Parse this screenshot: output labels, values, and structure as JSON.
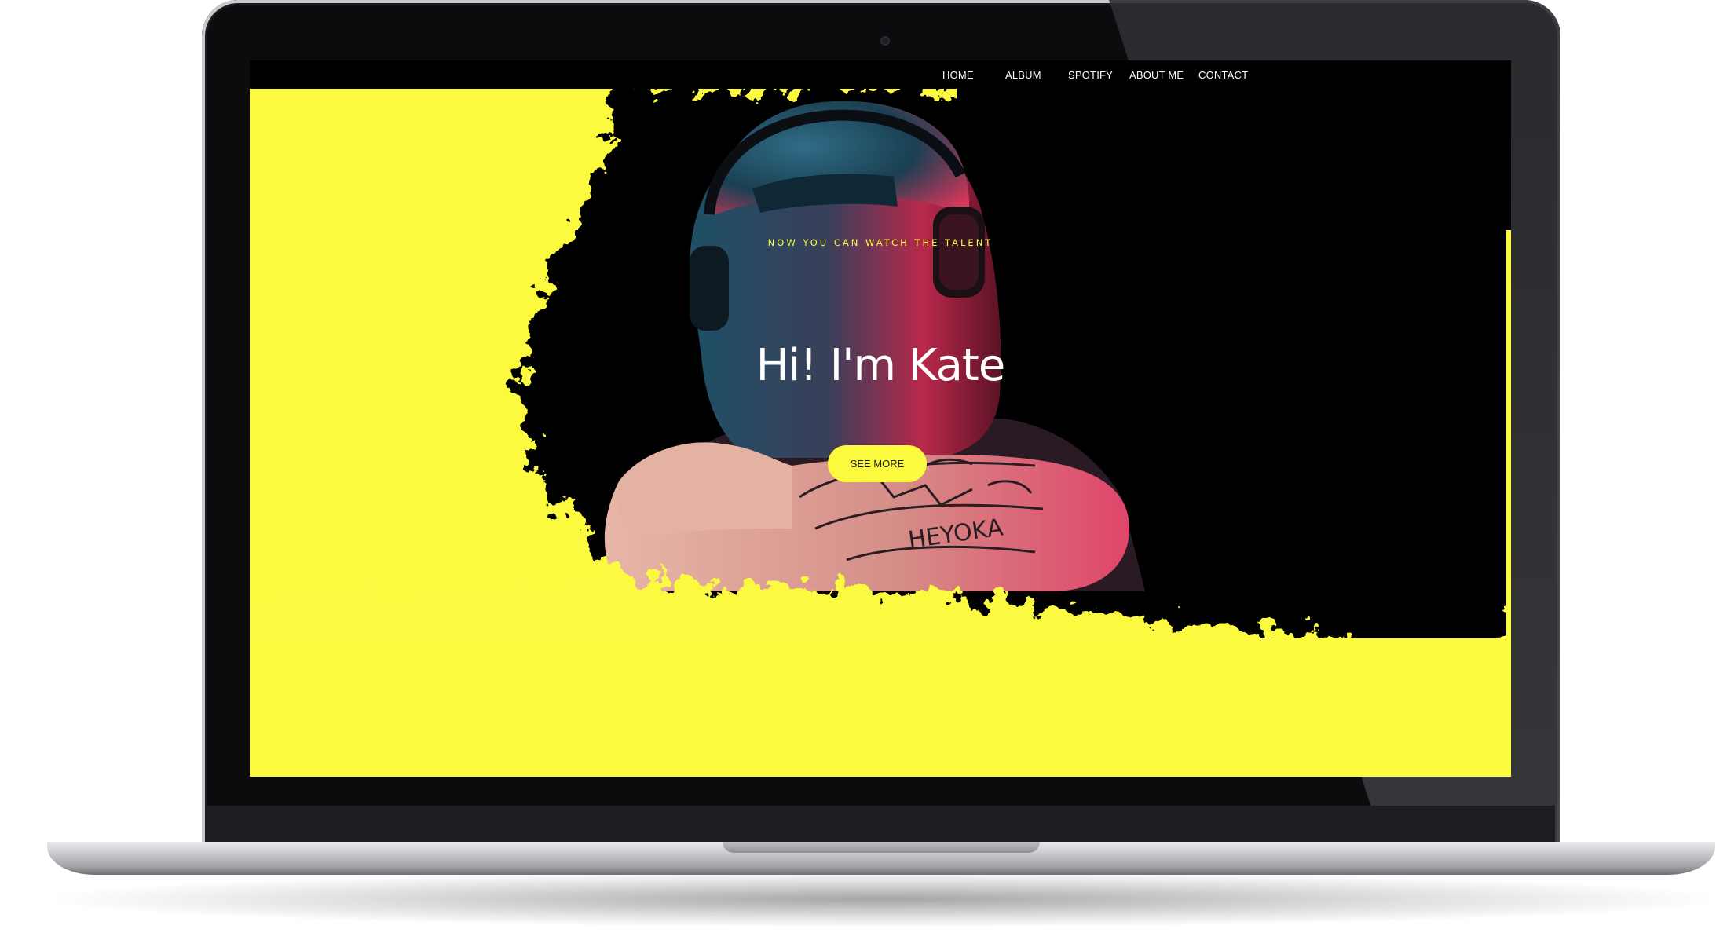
{
  "site": {
    "nav": {
      "home": "HOME",
      "album": "ALBUM",
      "spotify": "SPOTIFY",
      "about": "ABOUT ME",
      "contact": "CONTACT"
    },
    "hero": {
      "tagline": "NOW YOU CAN WATCH THE TALENT",
      "title": "Hi! I'm Kate",
      "cta_label": "SEE MORE",
      "tattoo_text": "HEYOKA"
    }
  },
  "colors": {
    "accent": "#fbfa3f",
    "background": "#000000",
    "text": "#ffffff"
  },
  "icons": {
    "camera": "webcam-dot"
  }
}
